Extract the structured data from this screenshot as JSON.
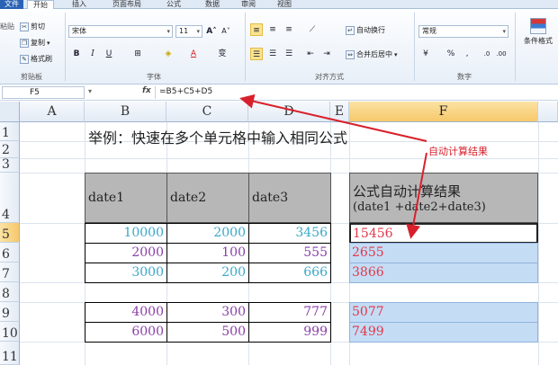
{
  "tabs": [
    "文件",
    "开始",
    "插入",
    "页面布局",
    "公式",
    "数据",
    "审阅",
    "视图"
  ],
  "ribbon": {
    "clipboard": {
      "paste": "粘贴",
      "cut": "剪切",
      "copy": "复制",
      "format_painter": "格式刷",
      "label": "剪贴板"
    },
    "font": {
      "name": "宋体",
      "size": "11",
      "bold": "B",
      "italic": "I",
      "underline": "U",
      "label": "字体",
      "phonetic": "变"
    },
    "alignment": {
      "wrap": "自动换行",
      "merge": "合并后居中",
      "label": "对齐方式"
    },
    "number": {
      "format": "常规",
      "percent": "%",
      "comma": ",",
      "label": "数字"
    },
    "styles": {
      "conditional": "条件格式"
    }
  },
  "formula_bar": {
    "cell_ref": "F5",
    "fx": "fx",
    "formula": "=B5+C5+D5"
  },
  "columns": [
    "A",
    "B",
    "C",
    "D",
    "E",
    "F"
  ],
  "selected_column": "F",
  "rows": [
    "1",
    "2",
    "3",
    "4",
    "5",
    "6",
    "7",
    "8",
    "9",
    "10",
    "11"
  ],
  "selected_row": "5",
  "sheet": {
    "title": "举例：快速在多个单元格中输入相同公式",
    "headers": [
      "date1",
      "date2",
      "date3"
    ],
    "result_header_line1": "公式自动计算结果",
    "result_header_line2": "(date1 +date2+date3)",
    "data_rows": [
      {
        "row": "5",
        "b": "10000",
        "c": "2000",
        "d": "3456",
        "f": "15456",
        "color": "#3aa8c8"
      },
      {
        "row": "6",
        "b": "2000",
        "c": "100",
        "d": "555",
        "f": "2655",
        "color": "#8b3fa8"
      },
      {
        "row": "7",
        "b": "3000",
        "c": "200",
        "d": "666",
        "f": "3866",
        "color": "#3aa8c8"
      },
      {
        "row": "9",
        "b": "4000",
        "c": "300",
        "d": "777",
        "f": "5077",
        "color": "#8b3fa8"
      },
      {
        "row": "10",
        "b": "6000",
        "c": "500",
        "d": "999",
        "f": "7499",
        "color": "#8b3fa8"
      }
    ],
    "result_color": "#e0394a"
  },
  "annotation": "自动计算结果",
  "annotation_color": "#d8202b"
}
